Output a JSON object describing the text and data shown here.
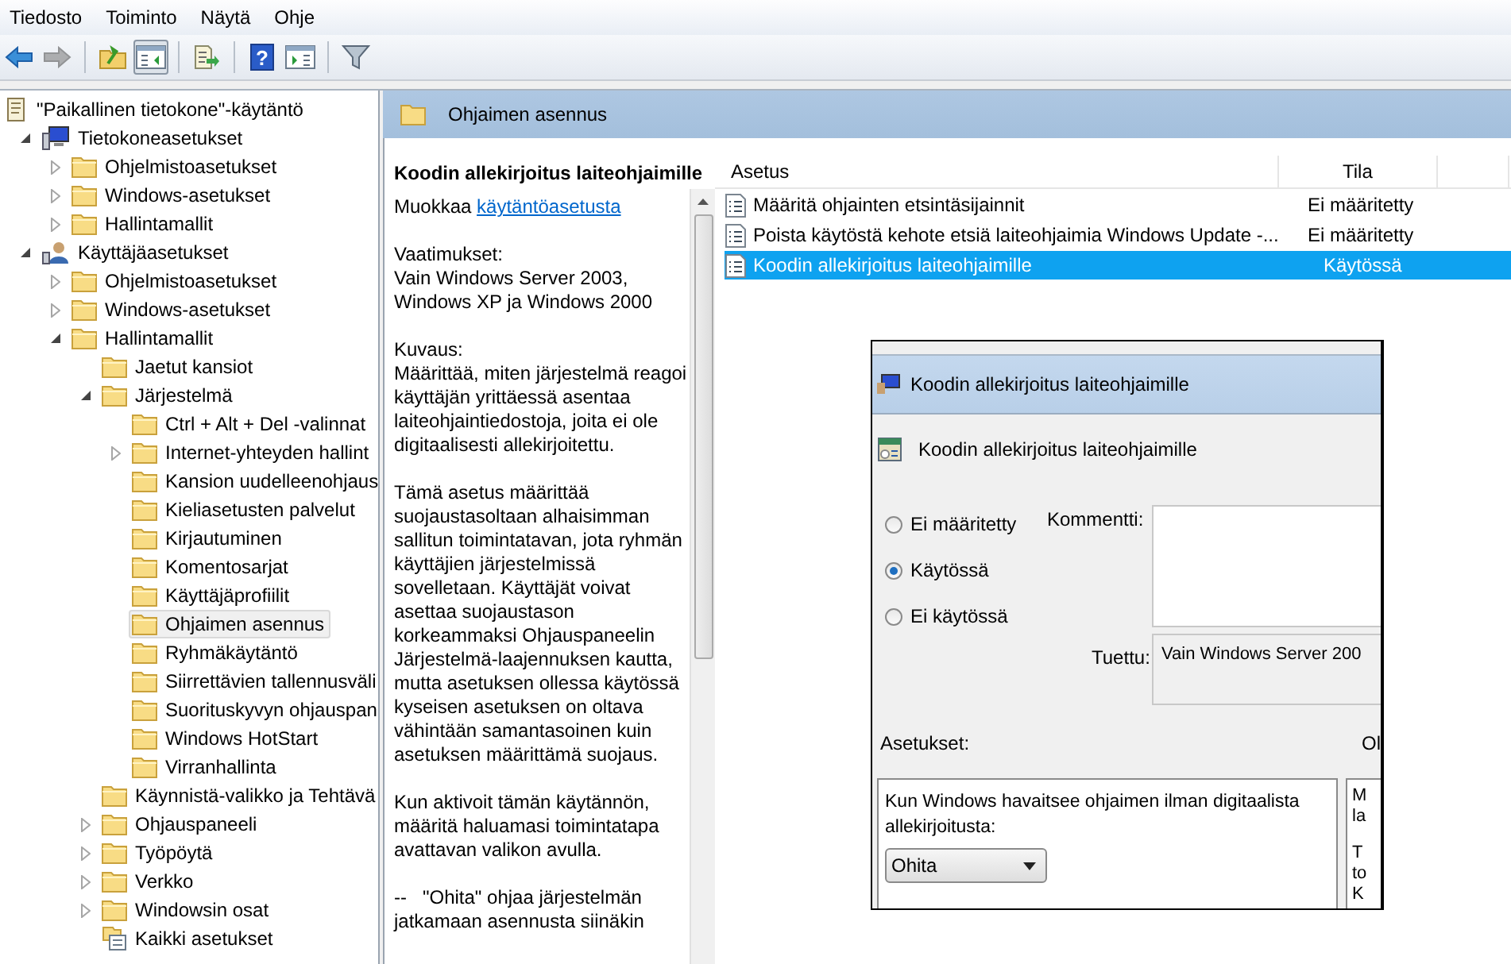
{
  "menu": [
    "Tiedosto",
    "Toiminto",
    "Näytä",
    "Ohje"
  ],
  "toolbar": [
    {
      "kind": "back",
      "disabled": false,
      "pressed": false
    },
    {
      "kind": "forward",
      "disabled": true,
      "pressed": false
    },
    {
      "kind": "up",
      "disabled": false,
      "pressed": false
    },
    {
      "kind": "tree",
      "disabled": false,
      "pressed": true
    },
    {
      "kind": "export",
      "disabled": false,
      "pressed": false
    },
    {
      "kind": "help",
      "label": "?",
      "disabled": false,
      "pressed": false
    },
    {
      "kind": "pane",
      "disabled": false,
      "pressed": false
    },
    {
      "kind": "filter",
      "disabled": false,
      "pressed": false
    }
  ],
  "tree": [
    {
      "label": "\"Paikallinen tietokone\"-käytäntö",
      "kind": "policy",
      "selected": false,
      "children": [
        {
          "label": "Tietokoneasetukset",
          "kind": "computer",
          "expanded": true,
          "selected": false,
          "children": [
            {
              "label": "Ohjelmistoasetukset",
              "kind": "folder",
              "expanded": false,
              "selected": false
            },
            {
              "label": "Windows-asetukset",
              "kind": "folder",
              "expanded": false,
              "selected": false
            },
            {
              "label": "Hallintamallit",
              "kind": "folder",
              "expanded": false,
              "selected": false
            }
          ]
        },
        {
          "label": "Käyttäjäasetukset",
          "kind": "user",
          "expanded": true,
          "selected": false,
          "children": [
            {
              "label": "Ohjelmistoasetukset",
              "kind": "folder",
              "expanded": false,
              "selected": false
            },
            {
              "label": "Windows-asetukset",
              "kind": "folder",
              "expanded": false,
              "selected": false
            },
            {
              "label": "Hallintamallit",
              "kind": "folder",
              "expanded": true,
              "selected": false,
              "children": [
                {
                  "label": "Jaetut kansiot",
                  "kind": "folder",
                  "selected": false
                },
                {
                  "label": "Järjestelmä",
                  "kind": "folder",
                  "expanded": true,
                  "selected": false,
                  "children": [
                    {
                      "label": "Ctrl + Alt + Del -valinnat",
                      "kind": "folder",
                      "selected": false
                    },
                    {
                      "label": "Internet-yhteyden hallint",
                      "kind": "folder",
                      "expanded": false,
                      "selected": false
                    },
                    {
                      "label": "Kansion uudelleenohjaus",
                      "kind": "folder",
                      "selected": false
                    },
                    {
                      "label": "Kieliasetusten palvelut",
                      "kind": "folder",
                      "selected": false
                    },
                    {
                      "label": "Kirjautuminen",
                      "kind": "folder",
                      "selected": false
                    },
                    {
                      "label": "Komentosarjat",
                      "kind": "folder",
                      "selected": false
                    },
                    {
                      "label": "Käyttäjäprofiilit",
                      "kind": "folder",
                      "selected": false
                    },
                    {
                      "label": "Ohjaimen asennus",
                      "kind": "folder",
                      "selected": true
                    },
                    {
                      "label": "Ryhmäkäytäntö",
                      "kind": "folder",
                      "selected": false
                    },
                    {
                      "label": "Siirrettävien tallennusväli",
                      "kind": "folder",
                      "selected": false
                    },
                    {
                      "label": "Suorituskyvyn ohjauspan",
                      "kind": "folder",
                      "selected": false
                    },
                    {
                      "label": "Windows HotStart",
                      "kind": "folder",
                      "selected": false
                    },
                    {
                      "label": "Virranhallinta",
                      "kind": "folder",
                      "selected": false
                    }
                  ]
                },
                {
                  "label": "Käynnistä-valikko ja Tehtävä",
                  "kind": "folder",
                  "selected": false
                },
                {
                  "label": "Ohjauspaneeli",
                  "kind": "folder",
                  "expanded": false,
                  "selected": false
                },
                {
                  "label": "Työpöytä",
                  "kind": "folder",
                  "expanded": false,
                  "selected": false
                },
                {
                  "label": "Verkko",
                  "kind": "folder",
                  "expanded": false,
                  "selected": false
                },
                {
                  "label": "Windowsin osat",
                  "kind": "folder",
                  "expanded": false,
                  "selected": false
                },
                {
                  "label": "Kaikki asetukset",
                  "kind": "settings",
                  "selected": false
                }
              ]
            }
          ]
        }
      ]
    }
  ],
  "header": {
    "title": "Ohjaimen asennus"
  },
  "description": {
    "title": "Koodin allekirjoitus laiteohjaimille",
    "edit_text": "Muokkaa",
    "edit_link": "käytäntöasetusta",
    "paragraphs": [
      [
        "Vaatimukset:",
        "Vain Windows Server 2003, Windows XP ja Windows 2000"
      ],
      [
        "Kuvaus:",
        "Määrittää, miten järjestelmä reagoi käyttäjän yrittäessä asentaa laiteohjaintiedostoja, joita ei ole digitaalisesti allekirjoitettu."
      ],
      [
        "Tämä asetus määrittää suojaustasoltaan alhaisimman sallitun toimintatavan, jota ryhmän käyttäjien järjestelmissä sovelletaan. Käyttäjät voivat asettaa suojaustason korkeammaksi Ohjauspaneelin Järjestelmä-laajennuksen kautta, mutta asetuksen ollessa käytössä kyseisen asetuksen on oltava vähintään samantasoinen kuin asetuksen määrittämä suojaus."
      ],
      [
        "Kun aktivoit tämän käytännön, määritä haluamasi toimintatapa avattavan valikon avulla."
      ],
      [
        "--   \"Ohita\" ohjaa järjestelmän jatkamaan asennusta siinäkin"
      ]
    ]
  },
  "table": {
    "columns": [
      "Asetus",
      "Tila"
    ],
    "rows": [
      {
        "setting": "Määritä ohjainten etsintäsijainnit",
        "state": "Ei määritetty",
        "selected": false
      },
      {
        "setting": "Poista käytöstä kehote etsiä laiteohjaimia Windows Update -...",
        "state": "Ei määritetty",
        "selected": false
      },
      {
        "setting": "Koodin allekirjoitus laiteohjaimille",
        "state": "Käytössä",
        "selected": true
      }
    ]
  },
  "dialog": {
    "title": "Koodin allekirjoitus laiteohjaimille",
    "heading": "Koodin allekirjoitus laiteohjaimille",
    "radios": [
      {
        "label": "Ei määritetty",
        "selected": false
      },
      {
        "label": "Käytössä",
        "selected": true
      },
      {
        "label": "Ei käytössä",
        "selected": false
      }
    ],
    "comment_label": "Kommentti:",
    "supported_label": "Tuettu:",
    "supported_value": "Vain Windows Server 200",
    "options_label": "Asetukset:",
    "help_label": "Ol",
    "option_text": "Kun Windows havaitsee ohjaimen ilman digitaalista allekirjoitusta:",
    "option_value": "Ohita",
    "help_paragraphs": [
      [
        "M",
        "la"
      ],
      [
        "T",
        "to",
        "K"
      ]
    ]
  }
}
